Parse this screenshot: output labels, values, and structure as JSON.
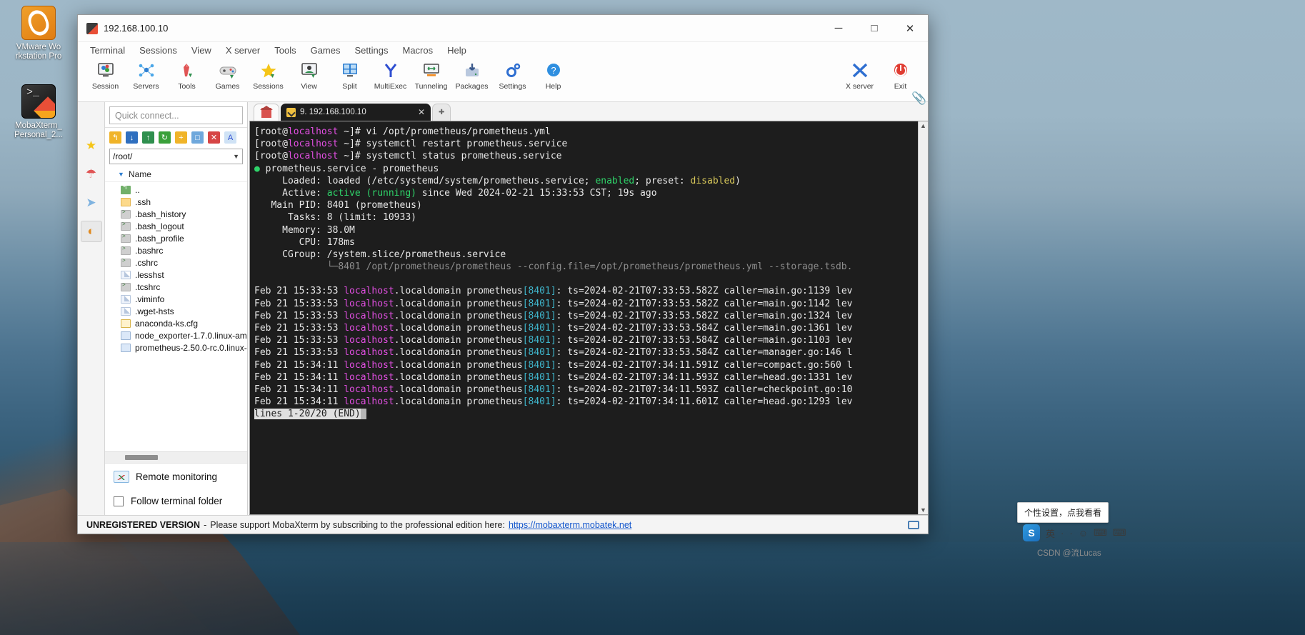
{
  "desktop": {
    "icons": [
      {
        "name": "vmware-workstation",
        "label": "VMware Wo\nrkstation Pro"
      },
      {
        "name": "mobaxterm",
        "label": "MobaXterm_\nPersonal_2..."
      }
    ]
  },
  "window": {
    "title": "192.168.100.10",
    "controls": {
      "minimize": "─",
      "maximize": "□",
      "close": "✕"
    }
  },
  "menubar": {
    "items": [
      "Terminal",
      "Sessions",
      "View",
      "X server",
      "Tools",
      "Games",
      "Settings",
      "Macros",
      "Help"
    ]
  },
  "toolbar": {
    "buttons": [
      {
        "label": "Session",
        "icon": "session-icon"
      },
      {
        "label": "Servers",
        "icon": "servers-icon"
      },
      {
        "label": "Tools",
        "icon": "tools-icon"
      },
      {
        "label": "Games",
        "icon": "games-icon"
      },
      {
        "label": "Sessions",
        "icon": "sessions-star-icon"
      },
      {
        "label": "View",
        "icon": "view-icon"
      },
      {
        "label": "Split",
        "icon": "split-icon"
      },
      {
        "label": "MultiExec",
        "icon": "multiexec-icon"
      },
      {
        "label": "Tunneling",
        "icon": "tunneling-icon"
      },
      {
        "label": "Packages",
        "icon": "packages-icon"
      },
      {
        "label": "Settings",
        "icon": "settings-gear-icon"
      },
      {
        "label": "Help",
        "icon": "help-question-icon"
      }
    ],
    "right_buttons": [
      {
        "label": "X server",
        "icon": "x-server-icon"
      },
      {
        "label": "Exit",
        "icon": "power-exit-icon"
      }
    ]
  },
  "sidebar": {
    "quick_connect_placeholder": "Quick connect...",
    "vertical_tabs": [
      {
        "name": "sessions-star-tab",
        "glyph": "★"
      },
      {
        "name": "tools-tab",
        "glyph": "☂"
      },
      {
        "name": "macros-tab",
        "glyph": "➤"
      },
      {
        "name": "sftp-tab",
        "glyph": "◐"
      }
    ],
    "sftp_tools": [
      {
        "name": "parent-folder-icon",
        "glyph": "↰",
        "color": "#f0b429"
      },
      {
        "name": "download-icon",
        "glyph": "↓",
        "color": "#2f6fbf"
      },
      {
        "name": "upload-icon",
        "glyph": "↑",
        "color": "#2f8f4e"
      },
      {
        "name": "refresh-icon",
        "glyph": "↻",
        "color": "#3aa03a"
      },
      {
        "name": "new-folder-icon",
        "glyph": "+",
        "color": "#f0b429"
      },
      {
        "name": "new-file-icon",
        "glyph": "□",
        "color": "#6fa8dc"
      },
      {
        "name": "delete-icon",
        "glyph": "✕",
        "color": "#d64545"
      },
      {
        "name": "text-mode-icon",
        "glyph": "A",
        "color": "#6fa8dc"
      }
    ],
    "path": "/root/",
    "column_header": "Name",
    "files": [
      {
        "name": "..",
        "type": "folder-up"
      },
      {
        "name": ".ssh",
        "type": "folder"
      },
      {
        "name": ".bash_history",
        "type": "script"
      },
      {
        "name": ".bash_logout",
        "type": "script"
      },
      {
        "name": ".bash_profile",
        "type": "script"
      },
      {
        "name": ".bashrc",
        "type": "script"
      },
      {
        "name": ".cshrc",
        "type": "script"
      },
      {
        "name": ".lesshst",
        "type": "doc"
      },
      {
        "name": ".tcshrc",
        "type": "script"
      },
      {
        "name": ".viminfo",
        "type": "doc"
      },
      {
        "name": ".wget-hsts",
        "type": "doc"
      },
      {
        "name": "anaconda-ks.cfg",
        "type": "cfg"
      },
      {
        "name": "node_exporter-1.7.0.linux-amd",
        "type": "gz"
      },
      {
        "name": "prometheus-2.50.0-rc.0.linux-a",
        "type": "gz"
      }
    ],
    "remote_monitoring_label": "Remote monitoring",
    "follow_terminal_label": "Follow terminal folder"
  },
  "tabs": {
    "home_label": "",
    "session_label": "9. 192.168.100.10",
    "close_glyph": "✕",
    "plus_glyph": "✚"
  },
  "terminal": {
    "lines": [
      [
        {
          "t": "[root@",
          "c": "white"
        },
        {
          "t": "localhost",
          "c": "magenta"
        },
        {
          "t": " ~]# vi /opt/prometheus/prometheus.yml",
          "c": "white"
        }
      ],
      [
        {
          "t": "[root@",
          "c": "white"
        },
        {
          "t": "localhost",
          "c": "magenta"
        },
        {
          "t": " ~]# systemctl restart prometheus.service",
          "c": "white"
        }
      ],
      [
        {
          "t": "[root@",
          "c": "white"
        },
        {
          "t": "localhost",
          "c": "magenta"
        },
        {
          "t": " ~]# systemctl status prometheus.service",
          "c": "white"
        }
      ],
      [
        {
          "t": "● ",
          "c": "green"
        },
        {
          "t": "prometheus.service - prometheus",
          "c": "white"
        }
      ],
      [
        {
          "t": "     Loaded: loaded (/etc/systemd/system/prometheus.service; ",
          "c": "white"
        },
        {
          "t": "enabled",
          "c": "green"
        },
        {
          "t": "; preset: ",
          "c": "white"
        },
        {
          "t": "disabled",
          "c": "yellow"
        },
        {
          "t": ")",
          "c": "white"
        }
      ],
      [
        {
          "t": "     Active: ",
          "c": "white"
        },
        {
          "t": "active (running)",
          "c": "green"
        },
        {
          "t": " since Wed 2024-02-21 15:33:53 CST; 19s ago",
          "c": "white"
        }
      ],
      [
        {
          "t": "   Main PID: 8401 (prometheus)",
          "c": "white"
        }
      ],
      [
        {
          "t": "      Tasks: 8 (limit: 10933)",
          "c": "white"
        }
      ],
      [
        {
          "t": "     Memory: 38.0M",
          "c": "white"
        }
      ],
      [
        {
          "t": "        CPU: 178ms",
          "c": "white"
        }
      ],
      [
        {
          "t": "     CGroup: /system.slice/prometheus.service",
          "c": "white"
        }
      ],
      [
        {
          "t": "             └─8401 /opt/prometheus/prometheus --config.file=/opt/prometheus/prometheus.yml --storage.tsdb.",
          "c": "dim"
        }
      ],
      [
        {
          "t": "",
          "c": "white"
        }
      ],
      [
        {
          "t": "Feb 21 15:33:53 ",
          "c": "white"
        },
        {
          "t": "localhost",
          "c": "magenta"
        },
        {
          "t": ".localdomain prometheus",
          "c": "white"
        },
        {
          "t": "[8401]",
          "c": "cyan"
        },
        {
          "t": ": ts=2024-02-21T07:33:53.582Z caller=main.go:1139 lev",
          "c": "white"
        }
      ],
      [
        {
          "t": "Feb 21 15:33:53 ",
          "c": "white"
        },
        {
          "t": "localhost",
          "c": "magenta"
        },
        {
          "t": ".localdomain prometheus",
          "c": "white"
        },
        {
          "t": "[8401]",
          "c": "cyan"
        },
        {
          "t": ": ts=2024-02-21T07:33:53.582Z caller=main.go:1142 lev",
          "c": "white"
        }
      ],
      [
        {
          "t": "Feb 21 15:33:53 ",
          "c": "white"
        },
        {
          "t": "localhost",
          "c": "magenta"
        },
        {
          "t": ".localdomain prometheus",
          "c": "white"
        },
        {
          "t": "[8401]",
          "c": "cyan"
        },
        {
          "t": ": ts=2024-02-21T07:33:53.582Z caller=main.go:1324 lev",
          "c": "white"
        }
      ],
      [
        {
          "t": "Feb 21 15:33:53 ",
          "c": "white"
        },
        {
          "t": "localhost",
          "c": "magenta"
        },
        {
          "t": ".localdomain prometheus",
          "c": "white"
        },
        {
          "t": "[8401]",
          "c": "cyan"
        },
        {
          "t": ": ts=2024-02-21T07:33:53.584Z caller=main.go:1361 lev",
          "c": "white"
        }
      ],
      [
        {
          "t": "Feb 21 15:33:53 ",
          "c": "white"
        },
        {
          "t": "localhost",
          "c": "magenta"
        },
        {
          "t": ".localdomain prometheus",
          "c": "white"
        },
        {
          "t": "[8401]",
          "c": "cyan"
        },
        {
          "t": ": ts=2024-02-21T07:33:53.584Z caller=main.go:1103 lev",
          "c": "white"
        }
      ],
      [
        {
          "t": "Feb 21 15:33:53 ",
          "c": "white"
        },
        {
          "t": "localhost",
          "c": "magenta"
        },
        {
          "t": ".localdomain prometheus",
          "c": "white"
        },
        {
          "t": "[8401]",
          "c": "cyan"
        },
        {
          "t": ": ts=2024-02-21T07:33:53.584Z caller=manager.go:146 l",
          "c": "white"
        }
      ],
      [
        {
          "t": "Feb 21 15:34:11 ",
          "c": "white"
        },
        {
          "t": "localhost",
          "c": "magenta"
        },
        {
          "t": ".localdomain prometheus",
          "c": "white"
        },
        {
          "t": "[8401]",
          "c": "cyan"
        },
        {
          "t": ": ts=2024-02-21T07:34:11.591Z caller=compact.go:560 l",
          "c": "white"
        }
      ],
      [
        {
          "t": "Feb 21 15:34:11 ",
          "c": "white"
        },
        {
          "t": "localhost",
          "c": "magenta"
        },
        {
          "t": ".localdomain prometheus",
          "c": "white"
        },
        {
          "t": "[8401]",
          "c": "cyan"
        },
        {
          "t": ": ts=2024-02-21T07:34:11.593Z caller=head.go:1331 lev",
          "c": "white"
        }
      ],
      [
        {
          "t": "Feb 21 15:34:11 ",
          "c": "white"
        },
        {
          "t": "localhost",
          "c": "magenta"
        },
        {
          "t": ".localdomain prometheus",
          "c": "white"
        },
        {
          "t": "[8401]",
          "c": "cyan"
        },
        {
          "t": ": ts=2024-02-21T07:34:11.593Z caller=checkpoint.go:10",
          "c": "white"
        }
      ],
      [
        {
          "t": "Feb 21 15:34:11 ",
          "c": "white"
        },
        {
          "t": "localhost",
          "c": "magenta"
        },
        {
          "t": ".localdomain prometheus",
          "c": "white"
        },
        {
          "t": "[8401]",
          "c": "cyan"
        },
        {
          "t": ": ts=2024-02-21T07:34:11.601Z caller=head.go:1293 lev",
          "c": "white"
        }
      ]
    ],
    "pager_status": "lines 1-20/20 (END)"
  },
  "statusbar": {
    "unregistered": "UNREGISTERED VERSION",
    "separator": "-",
    "message": "Please support MobaXterm by subscribing to the professional edition here:",
    "link": "https://mobaxterm.mobatek.net"
  },
  "overlay": {
    "tip": "个性设置，点我看看",
    "ime": {
      "logo": "S",
      "items": [
        "英",
        "·",
        "·",
        "☺",
        "⌨",
        "⌨"
      ]
    },
    "watermark": "CSDN @流Lucas"
  }
}
